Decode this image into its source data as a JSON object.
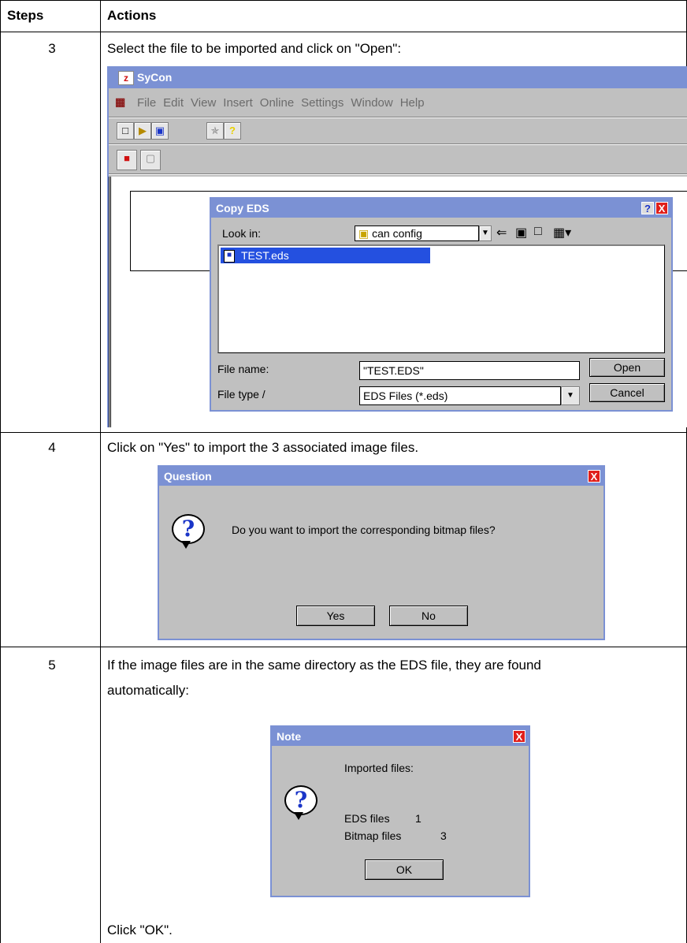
{
  "table": {
    "headers": {
      "steps": "Steps",
      "actions": "Actions"
    },
    "rows": [
      {
        "step": "3",
        "text": "Select the file to be imported and click on \"Open\":"
      },
      {
        "step": "4",
        "text": "Click on \"Yes\" to import the 3 associated image files."
      },
      {
        "step": "5",
        "text_line1": "If the image files are in the same directory as the EDS file, they are found",
        "text_line2": "automatically:",
        "footer": "Click \"OK\"."
      }
    ]
  },
  "sycon": {
    "title": "SyCon",
    "menu": [
      "File",
      "Edit",
      "View",
      "Insert",
      "Online",
      "Settings",
      "Window",
      "Help"
    ],
    "toolbar1": [
      "new-file-icon",
      "open-folder-icon",
      "save-disk-icon",
      "walk-figure-icon",
      "help-question-icon"
    ],
    "toolbar2": [
      "import-device-icon",
      "export-device-icon"
    ]
  },
  "copy_eds": {
    "title": "Copy EDS",
    "help_glyph": "?",
    "close_glyph": "X",
    "look_in_label": "Look in:",
    "look_in_value": "can config",
    "files": [
      "TEST.eds"
    ],
    "file_name_label": "File name:",
    "file_name_value": "\"TEST.EDS\"",
    "file_type_label": "File type /",
    "file_type_value": "EDS Files (*.eds)",
    "open_label": "Open",
    "cancel_label": "Cancel"
  },
  "question": {
    "title": "Question",
    "close_glyph": "X",
    "icon_glyph": "?",
    "message": "Do you want to import the corresponding bitmap files?",
    "yes_label": "Yes",
    "no_label": "No"
  },
  "note": {
    "title": "Note",
    "close_glyph": "X",
    "icon_glyph": "?",
    "imported_label": "Imported files:",
    "eds_label": "EDS files",
    "eds_count": "1",
    "bitmap_label": "Bitmap files",
    "bitmap_count": "3",
    "ok_label": "OK"
  },
  "colors": {
    "titlebar": "#7b91d4",
    "dialog_bg": "#c0c0c0",
    "close_red": "#e0201c",
    "selection": "#2450e0"
  }
}
